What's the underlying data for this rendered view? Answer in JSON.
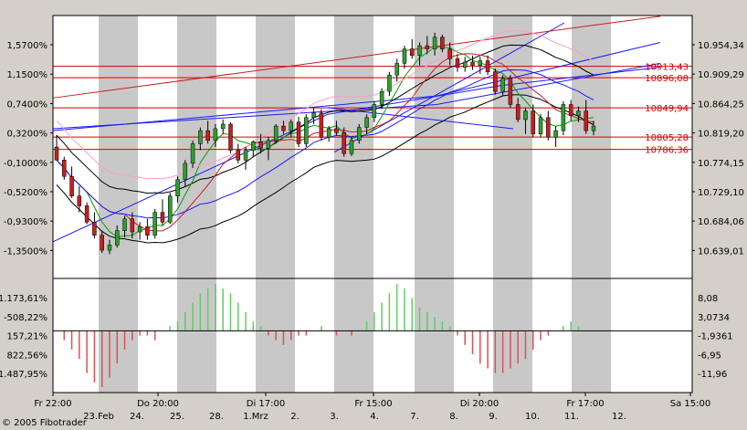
{
  "copyright": "© 2005 Fibotrader",
  "colors": {
    "background": "#d4d0c8",
    "plot": "#ffffff",
    "stripe": "#c8c8c8",
    "up_candle": "#2ea02e",
    "down_candle": "#c81e1e",
    "level_line": "#d40000",
    "trend_line": "#1a1aff",
    "band_line": "#000000",
    "pink_line": "#ff9cc8"
  },
  "chart_data": [
    {
      "type": "candlestick",
      "title": "",
      "y_left_ticks": [
        "1,5700%",
        "1,1500%",
        "0,7400%",
        "0,3200%",
        "-0,1000%",
        "-0,5200%",
        "-0,9300%",
        "-1,3500%"
      ],
      "y_right_ticks": [
        "10.954,34",
        "10.909,29",
        "10.864,25",
        "10.819,20",
        "10.774,15",
        "10.729,10",
        "10.684,06",
        "10.639,01"
      ],
      "ylim": [
        10600,
        10980
      ],
      "level_labels": [
        {
          "label": "10913,43",
          "value": 10913.43
        },
        {
          "label": "10896,08",
          "value": 10896.08
        },
        {
          "label": "10849,94",
          "value": 10849.94
        },
        {
          "label": "10805,28",
          "value": 10805.28
        },
        {
          "label": "10786,36",
          "value": 10786.36
        }
      ],
      "candles": [
        [
          10790,
          10808,
          10780,
          10770
        ],
        [
          10770,
          10775,
          10740,
          10745
        ],
        [
          10745,
          10760,
          10712,
          10715
        ],
        [
          10715,
          10730,
          10690,
          10700
        ],
        [
          10700,
          10705,
          10672,
          10675
        ],
        [
          10675,
          10690,
          10650,
          10655
        ],
        [
          10655,
          10662,
          10628,
          10632
        ],
        [
          10632,
          10648,
          10626,
          10640
        ],
        [
          10640,
          10670,
          10636,
          10662
        ],
        [
          10662,
          10685,
          10652,
          10680
        ],
        [
          10680,
          10690,
          10650,
          10660
        ],
        [
          10660,
          10675,
          10648,
          10668
        ],
        [
          10668,
          10680,
          10648,
          10655
        ],
        [
          10655,
          10695,
          10650,
          10690
        ],
        [
          10690,
          10710,
          10670,
          10675
        ],
        [
          10675,
          10720,
          10672,
          10715
        ],
        [
          10715,
          10745,
          10705,
          10740
        ],
        [
          10740,
          10770,
          10730,
          10765
        ],
        [
          10765,
          10800,
          10758,
          10795
        ],
        [
          10795,
          10820,
          10785,
          10815
        ],
        [
          10815,
          10830,
          10795,
          10800
        ],
        [
          10800,
          10825,
          10790,
          10818
        ],
        [
          10818,
          10832,
          10810,
          10825
        ],
        [
          10825,
          10828,
          10780,
          10785
        ],
        [
          10785,
          10795,
          10765,
          10770
        ],
        [
          10770,
          10790,
          10755,
          10785
        ],
        [
          10785,
          10800,
          10775,
          10798
        ],
        [
          10798,
          10810,
          10780,
          10788
        ],
        [
          10788,
          10805,
          10770,
          10800
        ],
        [
          10800,
          10825,
          10795,
          10822
        ],
        [
          10822,
          10830,
          10810,
          10815
        ],
        [
          10815,
          10832,
          10805,
          10828
        ],
        [
          10828,
          10836,
          10790,
          10795
        ],
        [
          10795,
          10840,
          10790,
          10835
        ],
        [
          10835,
          10850,
          10825,
          10842
        ],
        [
          10842,
          10848,
          10800,
          10805
        ],
        [
          10805,
          10822,
          10798,
          10818
        ],
        [
          10818,
          10830,
          10808,
          10812
        ],
        [
          10812,
          10820,
          10775,
          10780
        ],
        [
          10780,
          10805,
          10776,
          10800
        ],
        [
          10800,
          10825,
          10795,
          10820
        ],
        [
          10820,
          10840,
          10810,
          10835
        ],
        [
          10835,
          10860,
          10828,
          10855
        ],
        [
          10855,
          10880,
          10848,
          10875
        ],
        [
          10875,
          10905,
          10868,
          10900
        ],
        [
          10900,
          10925,
          10890,
          10918
        ],
        [
          10918,
          10945,
          10910,
          10940
        ],
        [
          10940,
          10955,
          10925,
          10930
        ],
        [
          10930,
          10950,
          10915,
          10945
        ],
        [
          10945,
          10960,
          10932,
          10940
        ],
        [
          10940,
          10965,
          10930,
          10958
        ],
        [
          10958,
          10962,
          10935,
          10940
        ],
        [
          10940,
          10950,
          10915,
          10925
        ],
        [
          10925,
          10932,
          10905,
          10912
        ],
        [
          10912,
          10928,
          10905,
          10920
        ],
        [
          10920,
          10930,
          10908,
          10915
        ],
        [
          10915,
          10928,
          10902,
          10922
        ],
        [
          10922,
          10930,
          10900,
          10905
        ],
        [
          10905,
          10910,
          10870,
          10875
        ],
        [
          10875,
          10900,
          10868,
          10895
        ],
        [
          10895,
          10900,
          10850,
          10855
        ],
        [
          10855,
          10865,
          10828,
          10832
        ],
        [
          10832,
          10850,
          10810,
          10845
        ],
        [
          10845,
          10855,
          10805,
          10810
        ],
        [
          10810,
          10840,
          10805,
          10835
        ],
        [
          10835,
          10845,
          10800,
          10805
        ],
        [
          10805,
          10822,
          10790,
          10815
        ],
        [
          10815,
          10860,
          10808,
          10855
        ],
        [
          10855,
          10862,
          10830,
          10838
        ],
        [
          10838,
          10852,
          10828,
          10845
        ],
        [
          10845,
          10862,
          10810,
          10815
        ],
        [
          10815,
          10830,
          10808,
          10822
        ]
      ],
      "lines": [
        {
          "name": "",
          "color": "#1a1aff",
          "points": [
            [
              0,
              10645
            ],
            [
              43,
              10840
            ],
            [
              70,
              10884
            ],
            [
              95,
              10912
            ]
          ]
        },
        {
          "name": "",
          "color": "#1a1aff",
          "points": [
            [
              0,
              10818
            ],
            [
              60,
              10855
            ],
            [
              95,
              10918
            ]
          ]
        },
        {
          "name": "",
          "color": "#1a1aff",
          "points": [
            [
              0,
              10815
            ],
            [
              60,
              10868
            ],
            [
              95,
              10950
            ]
          ]
        },
        {
          "name": "",
          "color": "#1a1aff",
          "points": [
            [
              43,
              10850
            ],
            [
              72,
              10818
            ]
          ]
        },
        {
          "name": "",
          "color": "#1a1aff",
          "points": [
            [
              44,
              10782
            ],
            [
              80,
              10980
            ]
          ]
        },
        {
          "name": "",
          "color": "#c81e1e",
          "points": [
            [
              0,
              10865
            ],
            [
              95,
              10990
            ]
          ]
        }
      ]
    },
    {
      "type": "histogram",
      "title": "",
      "y_left_ticks": [
        "-1.173,61%",
        "-508,22%",
        "157,21%",
        "822,56%",
        "1.487,95%"
      ],
      "y_right_ticks": [
        "8,08",
        "3,0734",
        "-1,9361",
        "-6,95",
        "-11,96"
      ],
      "ylim": [
        -12,
        10
      ],
      "values": [
        0,
        -2,
        -4,
        -6,
        -9,
        -11,
        -12,
        -10,
        -7,
        -4,
        -2,
        -1,
        -1,
        -2,
        0,
        1,
        2,
        4,
        6,
        8,
        9,
        10,
        9,
        8,
        6,
        4,
        2,
        1,
        -1,
        -2,
        -3,
        -2,
        -1,
        -1,
        0,
        1,
        0,
        -1,
        0,
        -1,
        0,
        2,
        4,
        6,
        8,
        10,
        9,
        7,
        5,
        4,
        3,
        2,
        1,
        -1,
        -3,
        -5,
        -7,
        -8,
        -9,
        -9,
        -8,
        -7,
        -6,
        -4,
        -2,
        -1,
        0,
        1,
        2,
        1,
        0,
        0
      ]
    }
  ],
  "x_axis": {
    "top_labels": [
      "Fr 22:00",
      "Do 20:00",
      "Di 17:00",
      "Fr 15:00",
      "Di 20:00",
      "Fr 17:00",
      "Sa 15:00"
    ],
    "bottom_labels": [
      "23.Feb",
      "24.",
      "25.",
      "28.",
      "1.Mrz",
      "2.",
      "3.",
      "4.",
      "7.",
      "8.",
      "9.",
      "10.",
      "11.",
      "12."
    ]
  }
}
